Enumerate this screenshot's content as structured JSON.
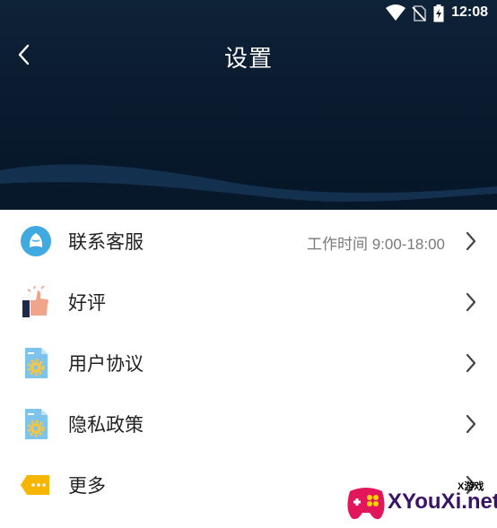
{
  "status_bar": {
    "time": "12:08",
    "icons": [
      "wifi-icon",
      "no-sim-icon",
      "battery-charging-icon"
    ]
  },
  "header": {
    "title": "设置",
    "back_icon": "back-arrow-icon"
  },
  "menu": {
    "items": [
      {
        "label": "联系客服",
        "hint": "工作时间 9:00-18:00",
        "icon": "customer-service-icon",
        "color": "#3fa9e0"
      },
      {
        "label": "好评",
        "hint": "",
        "icon": "thumbs-up-icon",
        "color": "#f0a58a"
      },
      {
        "label": "用户协议",
        "hint": "",
        "icon": "document-gear-icon",
        "color": "#7cc4ec"
      },
      {
        "label": "隐私政策",
        "hint": "",
        "icon": "document-gear-icon",
        "color": "#7cc4ec"
      },
      {
        "label": "更多",
        "hint": "",
        "icon": "more-tag-icon",
        "color": "#f6b600"
      }
    ]
  },
  "watermark": {
    "brand": "XYouXi.net",
    "tag": "X游戏"
  },
  "colors": {
    "header_background": "#0b1c30",
    "text_primary": "#222222",
    "text_secondary": "#7a7a7a"
  }
}
